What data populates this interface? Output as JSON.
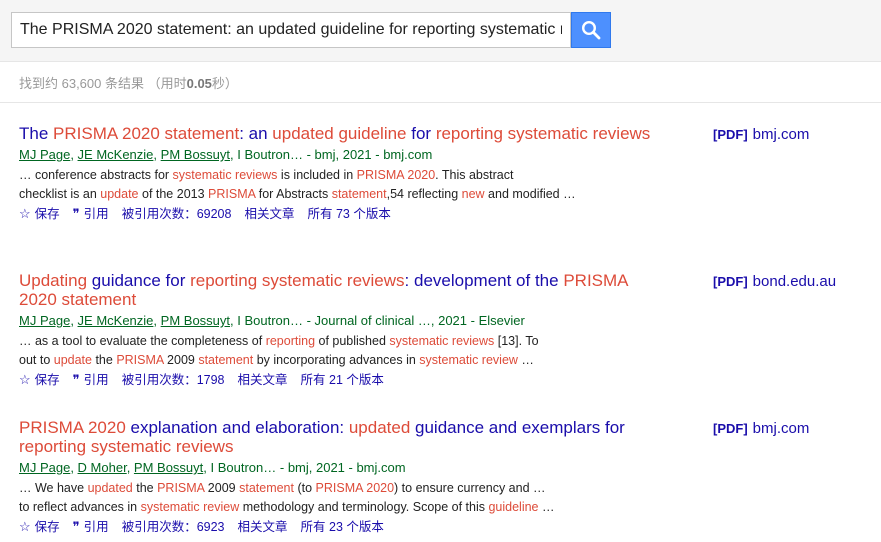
{
  "search": {
    "query": "The PRISMA 2020 statement: an updated guideline for reporting systematic r",
    "button_icon": "search-icon"
  },
  "stats": {
    "prefix": "找到约 63,600 条结果  （用时",
    "time": "0.05",
    "suffix": "秒）"
  },
  "results": [
    {
      "title_parts": [
        {
          "text": "The ",
          "hl": false
        },
        {
          "text": "PRISMA 2020 statement",
          "hl": true
        },
        {
          "text": ": an ",
          "hl": false
        },
        {
          "text": "updated guideline",
          "hl": true
        },
        {
          "text": " for ",
          "hl": false
        },
        {
          "text": "reporting systematic",
          "hl": true
        },
        {
          "text": " ",
          "hl": false
        },
        {
          "text": "reviews",
          "hl": true
        }
      ],
      "authors": [
        "MJ Page",
        "JE McKenzie",
        "PM Bossuyt"
      ],
      "author_rest": ", I Boutron… - bmj, 2021 - bmj.com",
      "snippet_lines": [
        [
          {
            "text": "… conference abstracts for ",
            "hl": false
          },
          {
            "text": "systematic reviews",
            "hl": true
          },
          {
            "text": " is included in ",
            "hl": false
          },
          {
            "text": "PRISMA 2020",
            "hl": true
          },
          {
            "text": ". This abstract",
            "hl": false
          }
        ],
        [
          {
            "text": "checklist is an ",
            "hl": false
          },
          {
            "text": "update",
            "hl": true
          },
          {
            "text": " of the 2013 ",
            "hl": false
          },
          {
            "text": "PRISMA",
            "hl": true
          },
          {
            "text": " for Abstracts ",
            "hl": false
          },
          {
            "text": "statement",
            "hl": true
          },
          {
            "text": ",54 reflecting ",
            "hl": false
          },
          {
            "text": "new",
            "hl": true
          },
          {
            "text": " and modified …",
            "hl": false
          }
        ]
      ],
      "actions": {
        "save": "保存",
        "cite": "引用",
        "cited_by": "被引用次数：69208",
        "related": "相关文章",
        "versions": "所有 73 个版本"
      },
      "pdf": {
        "tag": "[PDF]",
        "source": "bmj.com"
      }
    },
    {
      "title_parts": [
        {
          "text": "Updating",
          "hl": true
        },
        {
          "text": " guidance for ",
          "hl": false
        },
        {
          "text": "reporting systematic reviews",
          "hl": true
        },
        {
          "text": ": development of the ",
          "hl": false
        },
        {
          "text": "PRISMA",
          "hl": true
        },
        {
          "text": " ",
          "hl": false
        },
        {
          "text": "2020 statement",
          "hl": true
        }
      ],
      "authors": [
        "MJ Page",
        "JE McKenzie",
        "PM Bossuyt"
      ],
      "author_rest": ", I Boutron… - Journal of clinical …, 2021 - Elsevier",
      "snippet_lines": [
        [
          {
            "text": "… as a tool to evaluate the completeness of ",
            "hl": false
          },
          {
            "text": "reporting",
            "hl": true
          },
          {
            "text": " of published ",
            "hl": false
          },
          {
            "text": "systematic reviews",
            "hl": true
          },
          {
            "text": " [13]. To",
            "hl": false
          }
        ],
        [
          {
            "text": "out to ",
            "hl": false
          },
          {
            "text": "update",
            "hl": true
          },
          {
            "text": " the ",
            "hl": false
          },
          {
            "text": "PRISMA",
            "hl": true
          },
          {
            "text": " 2009 ",
            "hl": false
          },
          {
            "text": "statement",
            "hl": true
          },
          {
            "text": " by incorporating advances in ",
            "hl": false
          },
          {
            "text": "systematic review",
            "hl": true
          },
          {
            "text": " …",
            "hl": false
          }
        ]
      ],
      "actions": {
        "save": "保存",
        "cite": "引用",
        "cited_by": "被引用次数：1798",
        "related": "相关文章",
        "versions": "所有 21 个版本"
      },
      "pdf": {
        "tag": "[PDF]",
        "source": "bond.edu.au"
      }
    },
    {
      "title_parts": [
        {
          "text": "PRISMA 2020",
          "hl": true
        },
        {
          "text": " explanation and elaboration: ",
          "hl": false
        },
        {
          "text": "updated",
          "hl": true
        },
        {
          "text": " guidance and exemplars for ",
          "hl": false
        },
        {
          "text": "reporting systematic reviews",
          "hl": true
        }
      ],
      "authors": [
        "MJ Page",
        "D Moher",
        "PM Bossuyt"
      ],
      "author_rest": ", I Boutron… - bmj, 2021 - bmj.com",
      "snippet_lines": [
        [
          {
            "text": "… We have ",
            "hl": false
          },
          {
            "text": "updated",
            "hl": true
          },
          {
            "text": " the ",
            "hl": false
          },
          {
            "text": "PRISMA",
            "hl": true
          },
          {
            "text": " 2009 ",
            "hl": false
          },
          {
            "text": "statement",
            "hl": true
          },
          {
            "text": " (to ",
            "hl": false
          },
          {
            "text": "PRISMA 2020",
            "hl": true
          },
          {
            "text": ") to ensure currency and …",
            "hl": false
          }
        ],
        [
          {
            "text": "to reflect advances in ",
            "hl": false
          },
          {
            "text": "systematic review",
            "hl": true
          },
          {
            "text": " methodology and terminology. Scope of this ",
            "hl": false
          },
          {
            "text": "guideline",
            "hl": true
          },
          {
            "text": " …",
            "hl": false
          }
        ]
      ],
      "actions": {
        "save": "保存",
        "cite": "引用",
        "cited_by": "被引用次数：6923",
        "related": "相关文章",
        "versions": "所有 23 个版本"
      },
      "pdf": {
        "tag": "[PDF]",
        "source": "bmj.com"
      }
    }
  ],
  "icons": {
    "save": "star-outline-icon",
    "cite": "quote-icon"
  }
}
